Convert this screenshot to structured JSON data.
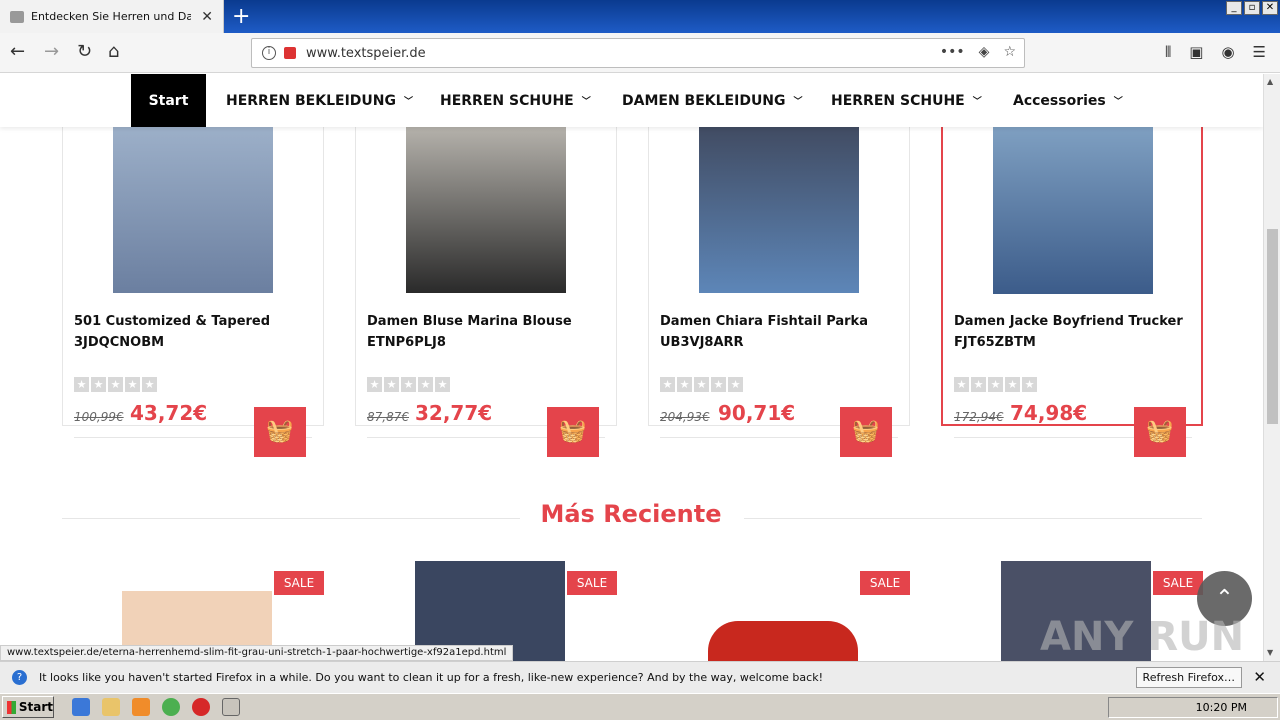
{
  "browser": {
    "tab_title": "Entdecken Sie Herren und Damen",
    "tab_close": "✕",
    "new_tab": "+",
    "url": "www.textspeier.de",
    "window_buttons": [
      "_",
      "▫",
      "✕"
    ]
  },
  "site": {
    "menu": [
      {
        "label": "Start"
      },
      {
        "label": "HERREN BEKLEIDUNG"
      },
      {
        "label": "HERREN SCHUHE"
      },
      {
        "label": "DAMEN BEKLEIDUNG"
      },
      {
        "label": "HERREN SCHUHE"
      },
      {
        "label": "Accessories"
      }
    ],
    "products": [
      {
        "name": "501 Customized & Tapered 3JDQCNOBM",
        "old_price": "100,99€",
        "new_price": "43,72€"
      },
      {
        "name": "Damen Bluse Marina Blouse ETNP6PLJ8",
        "old_price": "87,87€",
        "new_price": "32,77€"
      },
      {
        "name": "Damen Chiara Fishtail Parka UB3VJ8ARR",
        "old_price": "204,93€",
        "new_price": "90,71€"
      },
      {
        "name": "Damen Jacke Boyfriend Trucker FJT65ZBTM",
        "old_price": "172,94€",
        "new_price": "74,98€"
      }
    ],
    "section_title": "Más Reciente",
    "sale_badge": "SALE"
  },
  "status_link": "www.textspeier.de/eterna-herrenhemd-slim-fit-grau-uni-stretch-1-paar-hochwertige-xf92a1epd.html",
  "notification": {
    "message": "It looks like you haven't started Firefox in a while. Do you want to clean it up for a fresh, like-new experience? And by the way, welcome back!",
    "button": "Refresh Firefox…"
  },
  "taskbar": {
    "start": "Start",
    "clock": "10:20 PM"
  },
  "watermark": "ANY RUN",
  "colors": {
    "accent": "#e4444b"
  }
}
